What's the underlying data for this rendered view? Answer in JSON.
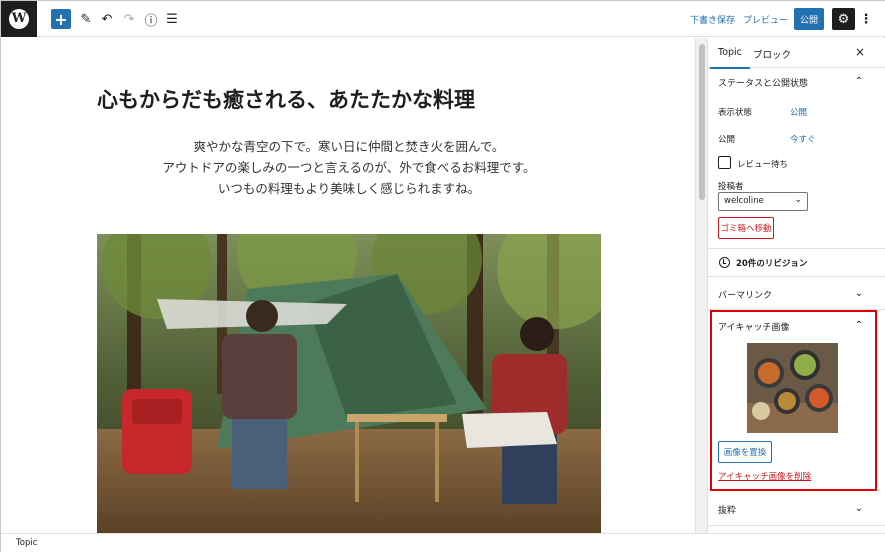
{
  "toolbar": {
    "logo": "W",
    "add_icon": "+",
    "pen_icon": "✎",
    "undo_icon": "↶",
    "redo_icon": "↷",
    "info_icon": "ⓘ",
    "list_icon": "☰",
    "save_draft": "下書き保存",
    "preview": "プレビュー",
    "publish": "公開",
    "settings_icon": "⚙",
    "more_icon": "⋮"
  },
  "post": {
    "title": "心もからだも癒される、あたたかな料理",
    "paragraph": [
      "爽やかな青空の下で。寒い日に仲間と焚き火を囲んで。",
      "アウトドアの楽しみの一つと言えるのが、外で食べるお料理です。",
      "いつもの料理もより美味しく感じられますね。"
    ]
  },
  "sidebar": {
    "tabs": [
      "Topic",
      "ブロック"
    ],
    "close_icon": "×",
    "status_panel": {
      "title": "ステータスと公開状態",
      "visibility_label": "表示状態",
      "visibility_value": "公開",
      "publish_label": "公開",
      "publish_value": "今すぐ",
      "pending_review": "レビュー待ち",
      "author_label": "投稿者",
      "author_value": "welcoline",
      "trash_button": "ゴミ箱へ移動"
    },
    "revisions": "20件のリビジョン",
    "permalink": "パーマリンク",
    "featured_image": {
      "title": "アイキャッチ画像",
      "replace_button": "画像を置換",
      "remove_link": "アイキャッチ画像を削除"
    },
    "excerpt": "抜粋"
  },
  "footer": {
    "breadcrumb": "Topic"
  },
  "colors": {
    "accent": "#2271b1",
    "danger": "#cc1818",
    "highlight": "#e00000"
  }
}
